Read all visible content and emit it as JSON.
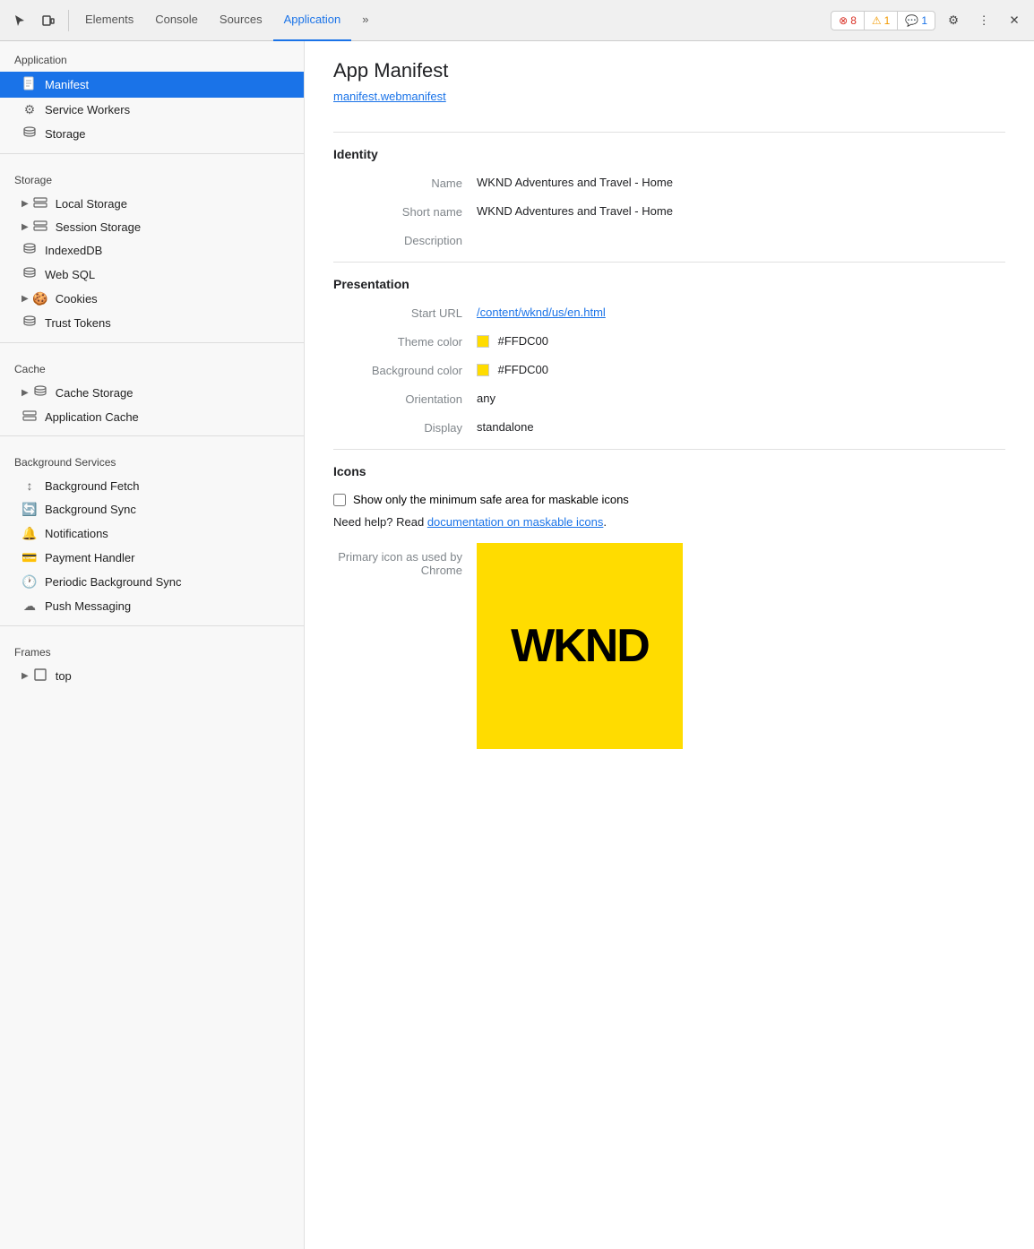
{
  "toolbar": {
    "tabs": [
      {
        "label": "Elements",
        "active": false
      },
      {
        "label": "Console",
        "active": false
      },
      {
        "label": "Sources",
        "active": false
      },
      {
        "label": "Application",
        "active": true
      },
      {
        "label": "»",
        "active": false
      }
    ],
    "badges": [
      {
        "icon": "error",
        "count": "8",
        "type": "error"
      },
      {
        "icon": "warn",
        "count": "1",
        "type": "warn"
      },
      {
        "icon": "info",
        "count": "1",
        "type": "info"
      }
    ]
  },
  "sidebar": {
    "applicationSection": "Application",
    "items_application": [
      {
        "label": "Manifest",
        "active": true
      },
      {
        "label": "Service Workers"
      },
      {
        "label": "Storage"
      }
    ],
    "storageSection": "Storage",
    "items_storage": [
      {
        "label": "Local Storage",
        "expandable": true
      },
      {
        "label": "Session Storage",
        "expandable": true
      },
      {
        "label": "IndexedDB"
      },
      {
        "label": "Web SQL"
      },
      {
        "label": "Cookies",
        "expandable": true
      },
      {
        "label": "Trust Tokens"
      }
    ],
    "cacheSection": "Cache",
    "items_cache": [
      {
        "label": "Cache Storage",
        "expandable": true
      },
      {
        "label": "Application Cache"
      }
    ],
    "bgServicesSection": "Background Services",
    "items_bgservices": [
      {
        "label": "Background Fetch"
      },
      {
        "label": "Background Sync"
      },
      {
        "label": "Notifications"
      },
      {
        "label": "Payment Handler"
      },
      {
        "label": "Periodic Background Sync"
      },
      {
        "label": "Push Messaging"
      }
    ],
    "framesSection": "Frames",
    "items_frames": [
      {
        "label": "top",
        "expandable": true
      }
    ]
  },
  "content": {
    "pageTitle": "App Manifest",
    "manifestLink": "manifest.webmanifest",
    "sections": {
      "identity": {
        "title": "Identity",
        "properties": [
          {
            "label": "Name",
            "value": "WKND Adventures and Travel - Home"
          },
          {
            "label": "Short name",
            "value": "WKND Adventures and Travel - Home"
          },
          {
            "label": "Description",
            "value": ""
          }
        ]
      },
      "presentation": {
        "title": "Presentation",
        "properties": [
          {
            "label": "Start URL",
            "value": "/content/wknd/us/en.html",
            "isLink": true
          },
          {
            "label": "Theme color",
            "value": "#FFDC00",
            "hasColor": true,
            "color": "#FFDC00"
          },
          {
            "label": "Background color",
            "value": "#FFDC00",
            "hasColor": true,
            "color": "#FFDC00"
          },
          {
            "label": "Orientation",
            "value": "any"
          },
          {
            "label": "Display",
            "value": "standalone"
          }
        ]
      },
      "icons": {
        "title": "Icons",
        "checkboxLabel": "Show only the minimum safe area for maskable icons",
        "helpText": "Need help? Read ",
        "helpLink": "documentation on maskable icons",
        "helpSuffix": ".",
        "primaryIconLabel": "Primary icon as used by",
        "primaryIconSublabel": "Chrome",
        "iconBgColor": "#FFDC00",
        "iconText": "WKND"
      }
    }
  }
}
